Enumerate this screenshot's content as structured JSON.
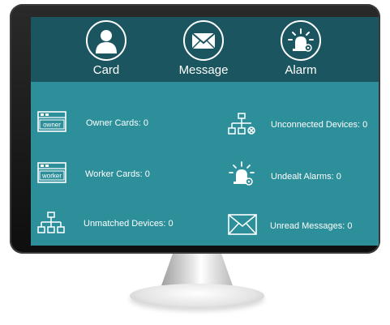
{
  "nav": {
    "card": {
      "label": "Card",
      "icon": "user-icon"
    },
    "message": {
      "label": "Message",
      "icon": "envelope-icon"
    },
    "alarm": {
      "label": "Alarm",
      "icon": "alarm-light-icon"
    }
  },
  "stats": {
    "owner_cards": {
      "label": "Owner Cards: 0",
      "icon": "owner-card-icon",
      "icon_text": "owner"
    },
    "worker_cards": {
      "label": "Worker Cards: 0",
      "icon": "worker-card-icon",
      "icon_text": "worker"
    },
    "unmatched_devices": {
      "label": "Unmatched Devices: 0",
      "icon": "network-icon"
    },
    "unconnected_devices": {
      "label": "Unconnected Devices: 0",
      "icon": "network-disconnected-icon"
    },
    "undealt_alarms": {
      "label": "Undealt Alarms: 0",
      "icon": "alarm-light-icon"
    },
    "unread_messages": {
      "label": "Unread Messages: 0",
      "icon": "envelope-icon"
    }
  },
  "colors": {
    "header_bg": "#1a5560",
    "content_bg": "#2c8f9a",
    "text": "#ffffff",
    "bezel": "#141414"
  }
}
